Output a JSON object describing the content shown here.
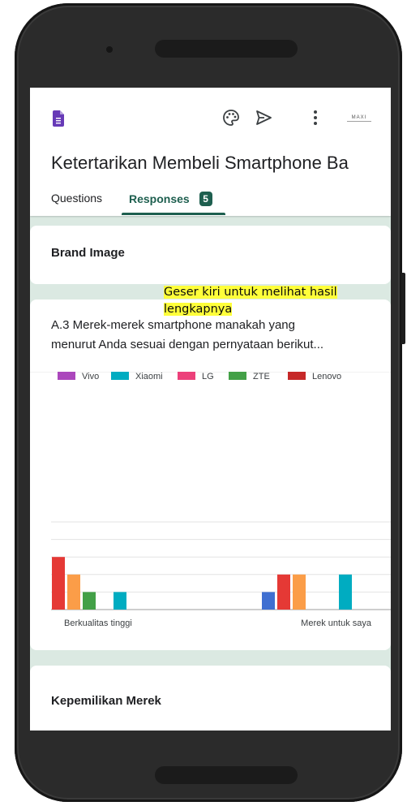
{
  "app": {
    "form_title": "Ketertarikan Membeli Smartphone Ba",
    "tabs": [
      {
        "label": "Questions"
      },
      {
        "label": "Responses",
        "badge": "5"
      }
    ],
    "icons": [
      "forms-icon",
      "palette-icon",
      "send-icon",
      "more-vert-icon",
      "avatar-logo"
    ],
    "logo_text": "MAXI"
  },
  "sections": {
    "brand_image": "Brand Image",
    "kepemilikan": "Kepemilikan Merek"
  },
  "question": {
    "text": "A.3 Merek-merek smartphone manakah yang menurut Anda sesuai dengan pernyataan berikut..."
  },
  "overlay_hint": "Geser kiri untuk melihat hasil lengkapnya",
  "chart_data": {
    "type": "bar",
    "legend_position": "top",
    "grid": true,
    "categories": [
      "Berkualitas tinggi",
      "Merek untuk saya"
    ],
    "series": [
      {
        "name": "Vivo",
        "color": "#ab47bc",
        "values": [
          0,
          0
        ]
      },
      {
        "name": "Xiaomi",
        "color": "#00acc1",
        "values": [
          1,
          2
        ]
      },
      {
        "name": "LG",
        "color": "#ec407a",
        "values": [
          0,
          0
        ]
      },
      {
        "name": "ZTE",
        "color": "#43a047",
        "values": [
          1,
          0
        ]
      },
      {
        "name": "Lenovo",
        "color": "#c62828",
        "values": [
          0,
          0
        ]
      },
      {
        "color": "#e53935",
        "values": [
          3,
          2
        ]
      },
      {
        "color": "#fb9d48",
        "values": [
          2,
          2
        ]
      },
      {
        "color": "#3f6fd1",
        "values": [
          0,
          1
        ]
      }
    ],
    "ylim": [
      0,
      5
    ]
  }
}
